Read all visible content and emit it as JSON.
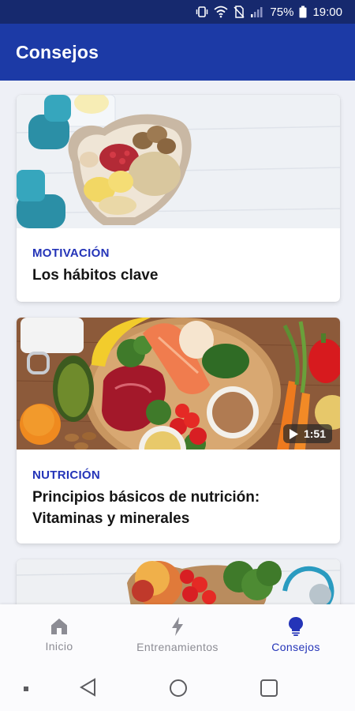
{
  "status_bar": {
    "battery_text": "75%",
    "time": "19:00"
  },
  "app_bar": {
    "title": "Consejos"
  },
  "cards": [
    {
      "category": "MOTIVACIÓN",
      "title": "Los hábitos clave"
    },
    {
      "category": "NUTRICIÓN",
      "title": "Principios básicos de nutrición: Vitaminas y minerales",
      "duration": "1:51"
    }
  ],
  "bottom_nav": {
    "items": [
      {
        "label": "Inicio",
        "icon": "home-icon"
      },
      {
        "label": "Entrenamientos",
        "icon": "bolt-icon"
      },
      {
        "label": "Consejos",
        "icon": "lightbulb-icon",
        "active": true
      }
    ]
  },
  "colors": {
    "status_bar": "#16296e",
    "app_bar": "#1c3aa6",
    "accent": "#2434b8"
  }
}
